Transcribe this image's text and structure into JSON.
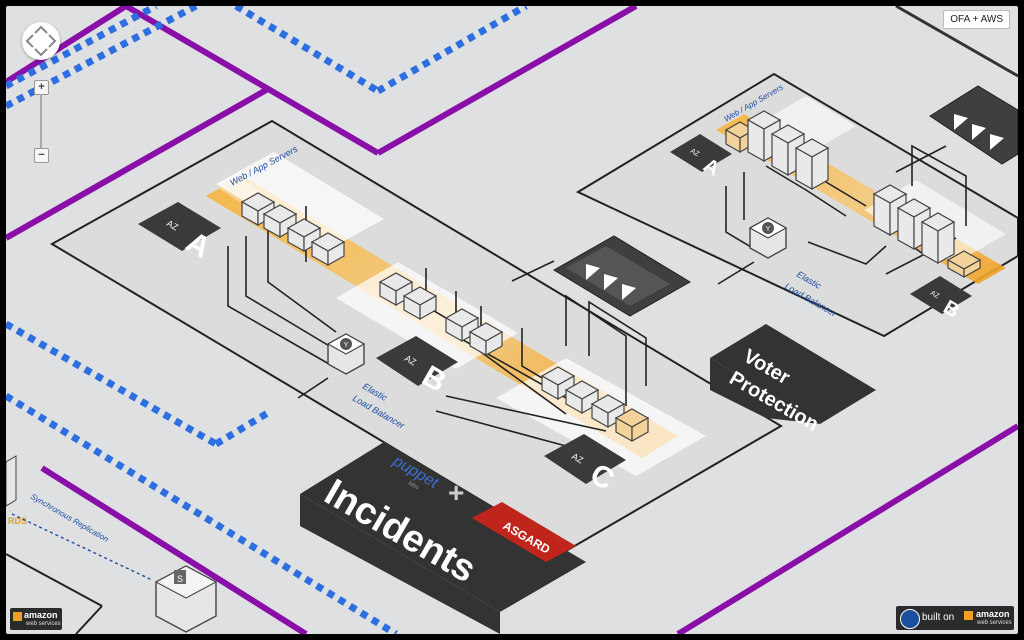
{
  "badge": {
    "label": "OFA + AWS"
  },
  "zoom": {
    "in": "+",
    "out": "−"
  },
  "left_cluster": {
    "servers_label": "Web / App Servers",
    "az_a": {
      "tag": "AZ",
      "letter": "A"
    },
    "az_b": {
      "tag": "AZ",
      "letter": "B"
    },
    "az_c": {
      "tag": "AZ",
      "letter": "C"
    },
    "elb_line1": "Elastic",
    "elb_line2": "Load Balancer"
  },
  "right_cluster": {
    "servers_label": "Web / App Servers",
    "az_a": {
      "tag": "AZ",
      "letter": "A"
    },
    "az_b": {
      "tag": "AZ",
      "letter": "B"
    },
    "elb_line1": "Elastic",
    "elb_line2": "Load Balancer"
  },
  "voter_protection": {
    "line1": "Voter",
    "line2": "Protection"
  },
  "incidents": {
    "title": "Incidents",
    "plus": "+",
    "puppet": "puppet",
    "puppet_sub": "labs",
    "asgard": "ASGARD"
  },
  "replication_label": "Synchronous Replication",
  "rds_label": "RDS",
  "s_label": "S",
  "footer": {
    "built_on": "built on",
    "amazon": "amazon",
    "web_services": "web services"
  },
  "colors": {
    "purple": "#8a0ea8",
    "blue_dash": "#2d6fe0",
    "orange": "#f0a020",
    "dark": "#3a3a3a"
  }
}
